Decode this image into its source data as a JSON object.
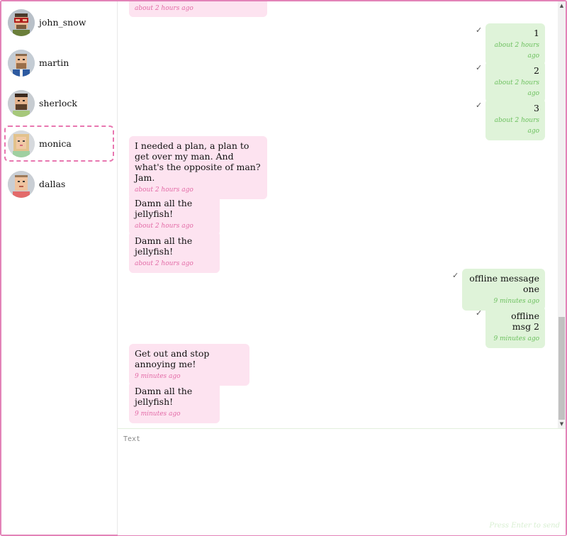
{
  "contacts": [
    {
      "name": "john_snow",
      "avatar_icon": "john-snow-avatar-icon"
    },
    {
      "name": "martin",
      "avatar_icon": "martin-avatar-icon"
    },
    {
      "name": "sherlock",
      "avatar_icon": "sherlock-avatar-icon"
    },
    {
      "name": "monica",
      "avatar_icon": "monica-avatar-icon",
      "selected": true
    },
    {
      "name": "dallas",
      "avatar_icon": "dallas-avatar-icon"
    }
  ],
  "messages": [
    {
      "direction": "incoming",
      "text": "",
      "time": "about 2 hours ago"
    },
    {
      "direction": "outgoing",
      "text": "1",
      "time": "about 2 hours ago",
      "status": "✓"
    },
    {
      "direction": "outgoing",
      "text": "2",
      "time": "about 2 hours ago",
      "status": "✓"
    },
    {
      "direction": "outgoing",
      "text": "3",
      "time": "about 2 hours ago",
      "status": "✓"
    },
    {
      "direction": "incoming",
      "text": "I needed a plan, a plan to get over my man. And what's the opposite of man? Jam.",
      "time": "about 2 hours ago"
    },
    {
      "direction": "incoming",
      "text": "Damn all the jellyfish!",
      "time": "about 2 hours ago"
    },
    {
      "direction": "incoming",
      "text": "Damn all the jellyfish!",
      "time": "about 2 hours ago"
    },
    {
      "direction": "outgoing",
      "text": "offline message one",
      "time": "9 minutes ago",
      "status": "✓"
    },
    {
      "direction": "outgoing",
      "text": "offline msg 2",
      "time": "9 minutes ago",
      "status": "✓"
    },
    {
      "direction": "incoming",
      "text": "Get out and stop annoying me!",
      "time": "9 minutes ago"
    },
    {
      "direction": "incoming",
      "text": "Damn all the jellyfish!",
      "time": "9 minutes ago"
    }
  ],
  "composer": {
    "placeholder": "Text",
    "hint": "Press Enter to send"
  },
  "colors": {
    "accent": "#e383b8",
    "incoming_bubble": "#fde3f0",
    "outgoing_bubble": "#dff3d9",
    "incoming_time": "#e36aa6",
    "outgoing_time": "#6cc05e"
  }
}
